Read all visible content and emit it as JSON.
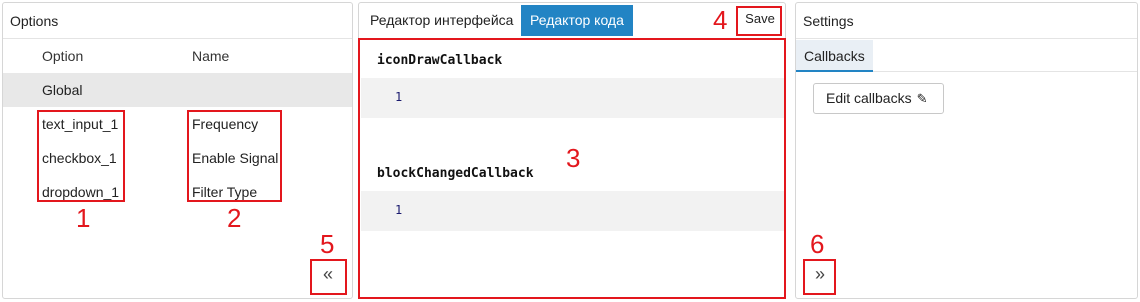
{
  "options_panel": {
    "title": "Options",
    "header": {
      "option": "Option",
      "name": "Name"
    },
    "global_row": "Global",
    "rows": [
      {
        "option": "text_input_1",
        "name": "Frequency"
      },
      {
        "option": "checkbox_1",
        "name": "Enable Signal"
      },
      {
        "option": "dropdown_1",
        "name": "Filter Type"
      }
    ],
    "collapse_button": "«"
  },
  "editor_panel": {
    "tabs": [
      {
        "label": "Редактор интерфейса",
        "active": false
      },
      {
        "label": "Редактор кода",
        "active": true
      }
    ],
    "save_label": "Save",
    "callbacks": [
      {
        "name": "iconDrawCallback",
        "line_number": "1"
      },
      {
        "name": "blockChangedCallback",
        "line_number": "1"
      }
    ]
  },
  "settings_panel": {
    "title": "Settings",
    "tab": "Callbacks",
    "edit_button": "Edit callbacks",
    "edit_icon": "pencil-icon",
    "expand_button": "»"
  },
  "annotations": {
    "color": "#e3171d",
    "labels": [
      "1",
      "2",
      "3",
      "4",
      "5",
      "6"
    ]
  },
  "colors": {
    "accent": "#2284c4",
    "global_row_bg": "#e8e8e8",
    "code_line_bg": "#f2f2f2"
  }
}
